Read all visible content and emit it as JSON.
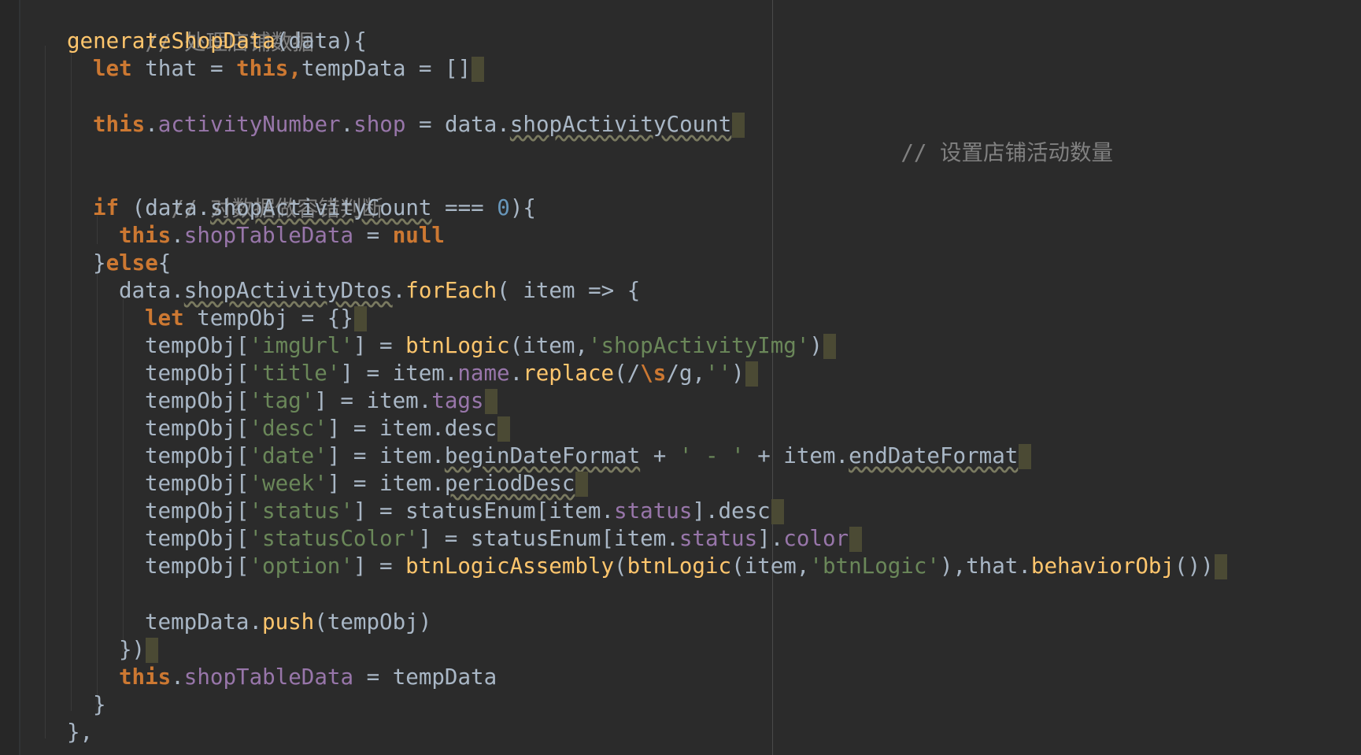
{
  "editor": {
    "lines": {
      "l1": {
        "comment": "// 处理店铺数据"
      },
      "l2": {
        "fn": "generateShopData",
        "rest": "(data){"
      },
      "l3": {
        "kw": "let",
        "a": " that = ",
        "kw2": "this,",
        "b": "tempData = []"
      },
      "l5": {
        "kw": "this",
        "dot": ".",
        "prop1": "activityNumber",
        "dot2": ".",
        "prop2": "shop",
        "eq": " = data.",
        "wavy": "shopActivityCount",
        "comment": "// 设置店铺活动数量"
      },
      "l7": {
        "comment": "// 对数据做容错判断"
      },
      "l8": {
        "kw": "if",
        "a": " (data.",
        "wavy": "shopActivityCount",
        "b": " === ",
        "num": "0",
        "c": "){"
      },
      "l9": {
        "kw": "this",
        "dot": ".",
        "prop": "shopTableData",
        "eq": " = ",
        "kw2": "null"
      },
      "l10": {
        "brace": "}",
        "kw": "else",
        "rest": "{"
      },
      "l11": {
        "a": "data.",
        "wavy": "shopActivityDtos",
        "dot": ".",
        "fn": "forEach",
        "b": "( item => {"
      },
      "l12": {
        "kw": "let",
        "a": " tempObj = {}"
      },
      "l13": {
        "a": "tempObj[",
        "str": "'imgUrl'",
        "b": "] = ",
        "fn": "btnLogic",
        "c": "(item,",
        "str2": "'shopActivityImg'",
        "d": ")"
      },
      "l14": {
        "a": "tempObj[",
        "str": "'title'",
        "b": "] = item.",
        "prop": "name",
        "dot": ".",
        "fn": "replace",
        "c": "(/",
        "kw": "\\s",
        "d": "/g,",
        "str2": "''",
        "e": ")"
      },
      "l15": {
        "a": "tempObj[",
        "str": "'tag'",
        "b": "] = item.",
        "prop": "tags"
      },
      "l16": {
        "a": "tempObj[",
        "str": "'desc'",
        "b": "] = item.desc"
      },
      "l17": {
        "a": "tempObj[",
        "str": "'date'",
        "b": "] = item.",
        "wavy": "beginDateFormat",
        "c": " + ",
        "str2": "' - '",
        "d": " + item.",
        "wavy2": "endDateFormat"
      },
      "l18": {
        "a": "tempObj[",
        "str": "'week'",
        "b": "] = item.",
        "wavy": "periodDesc"
      },
      "l19": {
        "a": "tempObj[",
        "str": "'status'",
        "b": "] = statusEnum[item.",
        "prop": "status",
        "c": "].desc"
      },
      "l20": {
        "a": "tempObj[",
        "str": "'statusColor'",
        "b": "] = statusEnum[item.",
        "prop": "status",
        "c": "].",
        "prop2": "color"
      },
      "l21": {
        "a": "tempObj[",
        "str": "'option'",
        "b": "] = ",
        "fn": "btnLogicAssembly",
        "c": "(",
        "fn2": "btnLogic",
        "d": "(item,",
        "str2": "'btnLogic'",
        "e": "),that.",
        "fn3": "behaviorObj",
        "f": "())"
      },
      "l23": {
        "a": "tempData.",
        "fn": "push",
        "b": "(tempObj)"
      },
      "l24": {
        "a": "})"
      },
      "l25": {
        "kw": "this",
        "dot": ".",
        "prop": "shopTableData",
        "eq": " = tempData"
      },
      "l26": {
        "a": "}"
      },
      "l27": {
        "a": "},",
        "kw": ""
      }
    }
  }
}
